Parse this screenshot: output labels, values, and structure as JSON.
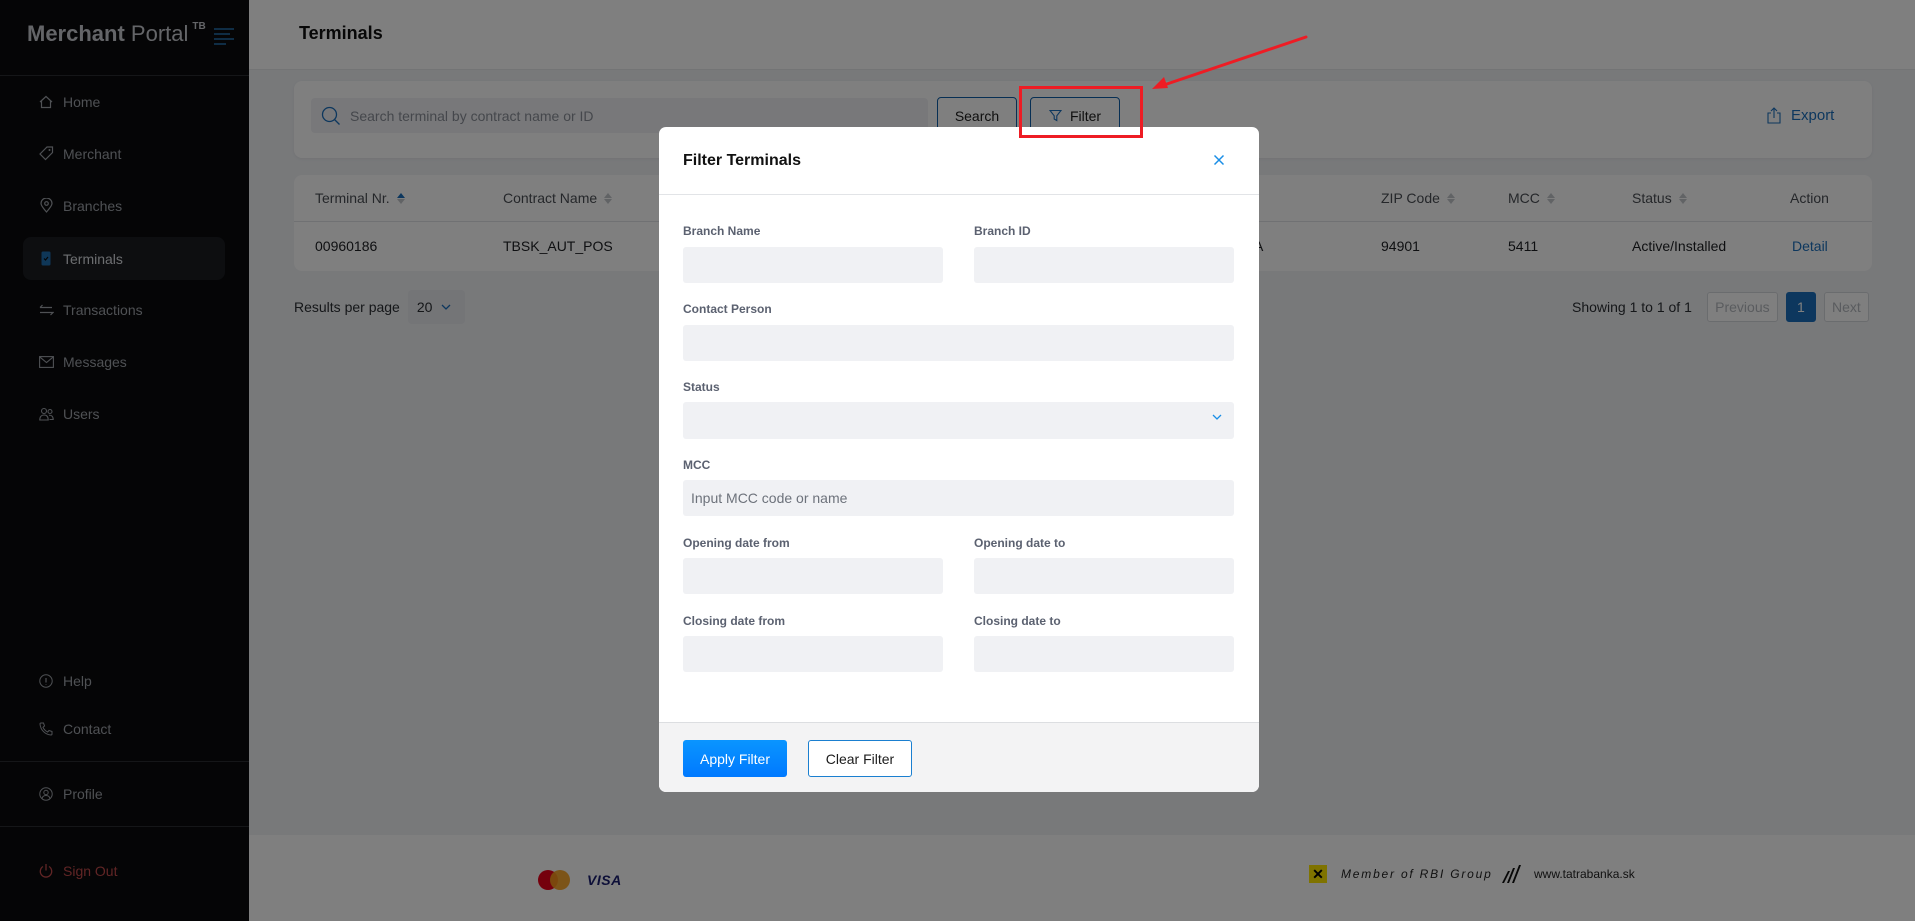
{
  "app": {
    "logo_bold": "Merchant",
    "logo_light": "Portal",
    "logo_sup": "TB"
  },
  "sidebar": {
    "items": [
      {
        "label": "Home",
        "icon": "home-icon"
      },
      {
        "label": "Merchant",
        "icon": "tag-icon"
      },
      {
        "label": "Branches",
        "icon": "map-pin-icon"
      },
      {
        "label": "Terminals",
        "icon": "terminal-device-icon",
        "active": true
      },
      {
        "label": "Transactions",
        "icon": "arrows-exchange-icon"
      },
      {
        "label": "Messages",
        "icon": "envelope-icon"
      },
      {
        "label": "Users",
        "icon": "users-icon"
      }
    ],
    "bottom": [
      {
        "label": "Help",
        "icon": "info-circle-icon"
      },
      {
        "label": "Contact",
        "icon": "phone-icon"
      }
    ],
    "profile": {
      "label": "Profile",
      "icon": "user-circle-icon"
    },
    "signout": {
      "label": "Sign Out",
      "icon": "power-icon"
    }
  },
  "header": {
    "title": "Terminals"
  },
  "search": {
    "placeholder": "Search terminal by contract name or ID",
    "value": "",
    "search_label": "Search",
    "filter_label": "Filter",
    "export_label": "Export"
  },
  "table": {
    "columns": [
      {
        "label": "Terminal Nr.",
        "sort": "asc"
      },
      {
        "label": "Contract Name",
        "sort": "none"
      },
      {
        "label": "ZIP Code",
        "sort": "none"
      },
      {
        "label": "MCC",
        "sort": "none"
      },
      {
        "label": "Status",
        "sort": "none"
      },
      {
        "label": "Action",
        "sort": null
      }
    ],
    "rows": [
      {
        "terminal_nr": "00960186",
        "contract_name": "TBSK_AUT_POS",
        "partial_hidden": "A",
        "zip_code": "94901",
        "mcc": "5411",
        "status": "Active/Installed",
        "action": "Detail"
      }
    ]
  },
  "pagination": {
    "results_per_page_label": "Results per page",
    "results_per_page": "20",
    "showing": "Showing 1 to 1 of 1",
    "previous": "Previous",
    "current_page": "1",
    "next": "Next"
  },
  "footer": {
    "card_brands": [
      "mastercard",
      "VISA"
    ],
    "rbi_text": "Member of RBI Group",
    "website": "www.tatrabanka.sk"
  },
  "modal": {
    "title": "Filter Terminals",
    "fields": {
      "branch_name": {
        "label": "Branch Name",
        "value": ""
      },
      "branch_id": {
        "label": "Branch ID",
        "value": ""
      },
      "contact_person": {
        "label": "Contact Person",
        "value": ""
      },
      "status": {
        "label": "Status",
        "value": ""
      },
      "mcc": {
        "label": "MCC",
        "placeholder": "Input MCC code or name",
        "value": ""
      },
      "opening_from": {
        "label": "Opening date from",
        "value": ""
      },
      "opening_to": {
        "label": "Opening date to",
        "value": ""
      },
      "closing_from": {
        "label": "Closing date from",
        "value": ""
      },
      "closing_to": {
        "label": "Closing date to",
        "value": ""
      }
    },
    "apply_label": "Apply Filter",
    "clear_label": "Clear Filter"
  },
  "colors": {
    "accent": "#1a6fbd",
    "primary_button": "#0a8cff",
    "annotation": "#ee1c24",
    "signout": "#c24a4a"
  }
}
